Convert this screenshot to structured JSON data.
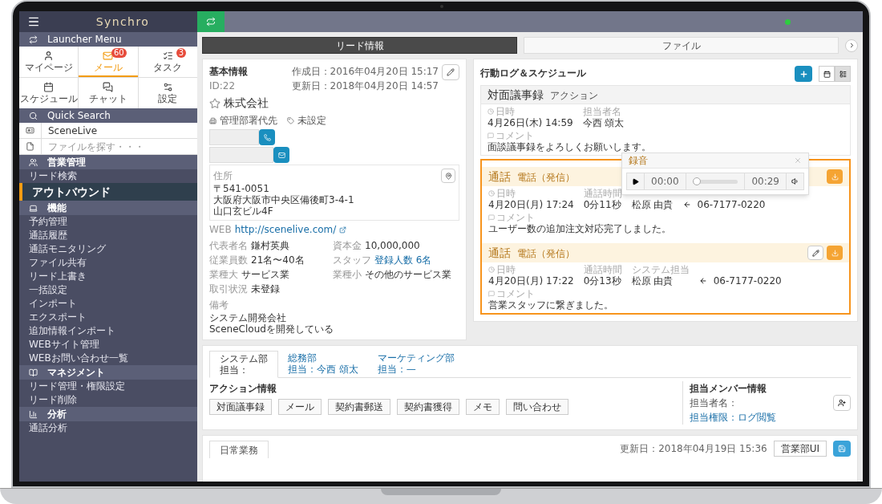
{
  "sidebar": {
    "logo": "Synchro",
    "launcher_title": "Launcher Menu",
    "tiles": [
      {
        "label": "マイページ",
        "selected": false
      },
      {
        "label": "メール",
        "selected": true,
        "badge": "60"
      },
      {
        "label": "タスク",
        "selected": false,
        "badge": "3"
      },
      {
        "label": "スケジュール",
        "selected": false
      },
      {
        "label": "チャット",
        "selected": false
      },
      {
        "label": "設定",
        "selected": false
      }
    ],
    "quick_search_title": "Quick Search",
    "quick_search": [
      {
        "kind": "value",
        "value": "SceneLive"
      },
      {
        "kind": "placeholder",
        "placeholder": "ファイルを探す・・・"
      }
    ],
    "nav": [
      {
        "kind": "section",
        "label": "営業管理"
      },
      {
        "kind": "item",
        "label": "リード検索",
        "selected": false
      },
      {
        "kind": "item",
        "label": "アウトバウンド",
        "selected": true
      },
      {
        "kind": "section",
        "label": "機能"
      },
      {
        "kind": "item",
        "label": "予約管理",
        "selected": false
      },
      {
        "kind": "item",
        "label": "通話履歴",
        "selected": false
      },
      {
        "kind": "item",
        "label": "通話モニタリング",
        "selected": false
      },
      {
        "kind": "item",
        "label": "ファイル共有",
        "selected": false
      },
      {
        "kind": "item",
        "label": "リード上書き",
        "selected": false
      },
      {
        "kind": "item",
        "label": "一括設定",
        "selected": false
      },
      {
        "kind": "item",
        "label": "インポート",
        "selected": false
      },
      {
        "kind": "item",
        "label": "エクスポート",
        "selected": false
      },
      {
        "kind": "item",
        "label": "追加情報インポート",
        "selected": false
      },
      {
        "kind": "item",
        "label": "WEBサイト管理",
        "selected": false
      },
      {
        "kind": "item",
        "label": "WEBお問い合わせ一覧",
        "selected": false
      },
      {
        "kind": "section",
        "label": "マネジメント"
      },
      {
        "kind": "item",
        "label": "リード管理・権限設定",
        "selected": false
      },
      {
        "kind": "item",
        "label": "リード削除",
        "selected": false
      },
      {
        "kind": "section",
        "label": "分析"
      },
      {
        "kind": "item",
        "label": "通話分析",
        "selected": false
      }
    ]
  },
  "top_bar": {
    "online": true
  },
  "tabs": [
    {
      "label": "リード情報",
      "selected": true
    },
    {
      "label": "ファイル",
      "selected": false
    }
  ],
  "basic_info": {
    "title": "基本情報",
    "id": "ID:22",
    "created": "作成日：2016年04月20日 15:17",
    "updated": "更新日：2018年04月20日 14:57",
    "company": "株式会社",
    "favorite": false,
    "tags": [
      "管理部署代先",
      "未設定"
    ],
    "address_label": "住所",
    "address": [
      "〒541-0051",
      "大阪府大阪市中央区備後町3-4-1",
      "山口玄ビル4F"
    ],
    "web_label": "WEB",
    "web": "http://scenelive.com/",
    "details": [
      {
        "label": "代表者名",
        "value": "鎌村英典",
        "link": false
      },
      {
        "label": "資本金",
        "value": "10,000,000",
        "link": false
      },
      {
        "label": "従業員数",
        "value": "21名〜40名",
        "link": false
      },
      {
        "label": "スタッフ",
        "value": "登録人数 6名",
        "link": true
      },
      {
        "label": "業種大",
        "value": "サービス業",
        "link": false
      },
      {
        "label": "業種小",
        "value": "その他のサービス業",
        "link": false
      },
      {
        "label": "取引状況",
        "value": "未登録",
        "link": false
      }
    ],
    "note_label": "備考",
    "note": [
      "システム開発会社",
      "SceneCloudを開発している"
    ]
  },
  "activity_log": {
    "title": "行動ログ＆スケジュール",
    "views": [
      {
        "kind": "calendar",
        "selected": false
      },
      {
        "kind": "list",
        "selected": true
      }
    ],
    "entries": [
      {
        "kind": "meeting",
        "title": "対面議事録",
        "subtitle": "アクション",
        "highlighted": false,
        "editable": false,
        "downloadable": false,
        "fields": [
          {
            "label": "日時",
            "value": "4月26日(木) 14:59"
          },
          {
            "label": "担当者名",
            "value": "今西 頌太"
          }
        ],
        "comment_label": "コメント",
        "comment": "面談議事録をよろしくお願いします。"
      },
      {
        "kind": "call",
        "title": "通話",
        "subtitle": "電話（発信）",
        "highlighted": true,
        "editable": false,
        "downloadable": true,
        "fields": [
          {
            "label": "日時",
            "value": "4月20日(月) 17:24"
          },
          {
            "label": "通話時間",
            "value": "0分11秒"
          },
          {
            "value": "松原 由貴"
          }
        ],
        "incoming": true,
        "number": "06-7177-0220",
        "comment_label": "コメント",
        "comment": "ユーザー数の追加注文対応完了しました。"
      },
      {
        "kind": "call",
        "title": "通話",
        "subtitle": "電話（発信）",
        "highlighted": true,
        "editable": true,
        "downloadable": true,
        "fields": [
          {
            "label": "日時",
            "value": "4月20日(月) 17:22"
          },
          {
            "label": "通話時間",
            "value": "0分13秒"
          },
          {
            "label": "システム担当",
            "value": "松原 由貴"
          }
        ],
        "incoming": true,
        "number": "06-7177-0220",
        "comment_label": "コメント",
        "comment": "営業スタッフに繋ぎました。"
      }
    ]
  },
  "recording_popup": {
    "title": "録音",
    "current": "00:00",
    "duration": "00:29",
    "level": 0
  },
  "departments": [
    {
      "name": "システム部",
      "owner": "担当：",
      "selected": true
    },
    {
      "name": "総務部",
      "owner": "担当：今西 頌太",
      "selected": false
    },
    {
      "name": "マーケティング部",
      "owner": "担当：—",
      "selected": false
    }
  ],
  "action_info": {
    "title": "アクション情報",
    "buttons": [
      "対面議事録",
      "メール",
      "契約書郵送",
      "契約書獲得",
      "メモ",
      "問い合わせ"
    ]
  },
  "member_info": {
    "title": "担当メンバー情報",
    "person": "担当者名：",
    "permission": "担当権限：ログ閲覧"
  },
  "business": {
    "tab": "日常業務",
    "updated": "更新日：2018年04月19日 15:36",
    "button": "営業部UI"
  }
}
